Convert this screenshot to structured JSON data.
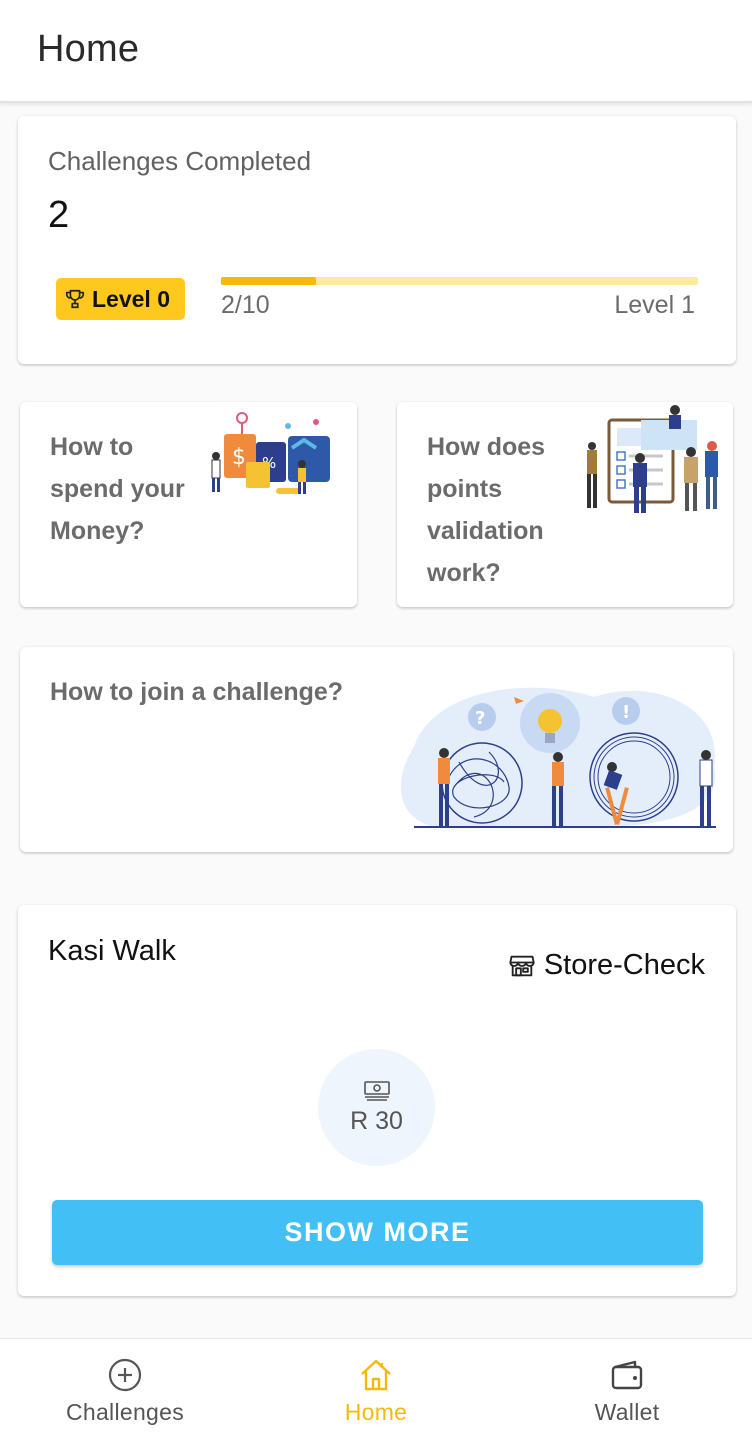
{
  "app_bar": {
    "title": "Home"
  },
  "progress": {
    "label": "Challenges Completed",
    "count": "2",
    "level_badge": "Level 0",
    "progress_text": "2/10",
    "progress_fraction": 0.2,
    "next_level": "Level 1",
    "colors": {
      "badge": "#ffc81e",
      "bar_fill": "#f5b90d",
      "bar_track": "#ffe8a5"
    }
  },
  "info_cards": {
    "spend": "How to spend your Money?",
    "points": "How does points validation work?",
    "join": "How to join a challenge?"
  },
  "challenge": {
    "title": "Kasi Walk",
    "type_icon": "store-icon",
    "type": "Store-Check",
    "reward_icon": "money-icon",
    "reward": "R 30",
    "button": "SHOW MORE",
    "button_color": "#42c0f5"
  },
  "bottom_nav": {
    "items": [
      {
        "label": "Challenges",
        "icon": "plus-circle-icon",
        "active": false
      },
      {
        "label": "Home",
        "icon": "home-icon",
        "active": true
      },
      {
        "label": "Wallet",
        "icon": "wallet-icon",
        "active": false
      }
    ],
    "active_color": "#f5b90d"
  }
}
